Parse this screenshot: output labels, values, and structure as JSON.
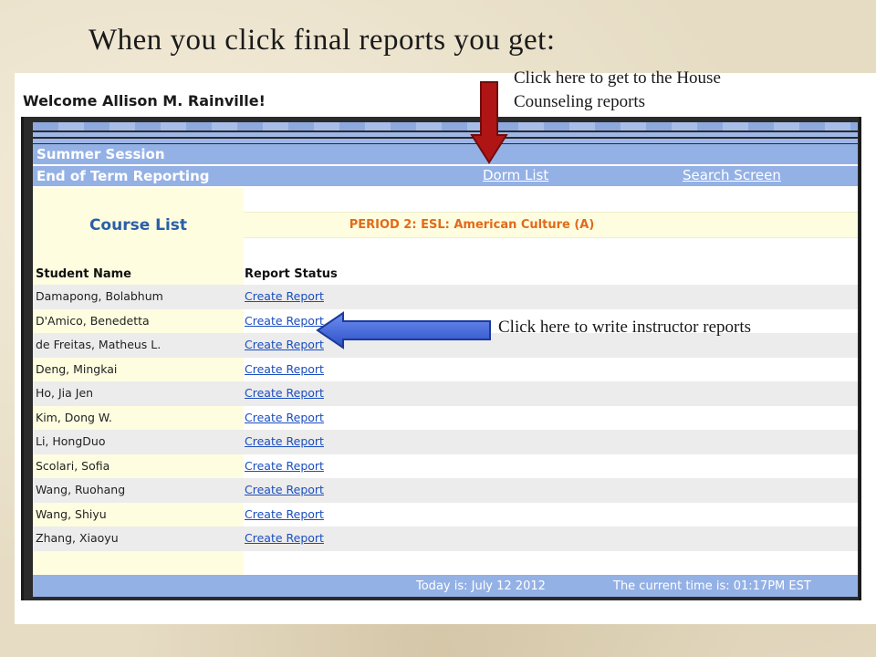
{
  "slide": {
    "title": "When you click final reports you get:"
  },
  "annotations": {
    "top_line1": "Click here to get to the House",
    "top_line2": "Counseling reports",
    "middle": "Click here to write instructor reports",
    "down_arrow_color": "#b01515",
    "left_arrow_color": "#3d63d6"
  },
  "app": {
    "welcome": "Welcome Allison M. Rainville!",
    "session_label": "Summer Session",
    "term_label": "End of Term Reporting",
    "nav_links": {
      "dorm_list": "Dorm List",
      "search_screen": "Search Screen"
    },
    "course_list_title": "Course List",
    "period_title": "PERIOD 2: ESL: American Culture (A)",
    "table": {
      "headers": {
        "student_name": "Student Name",
        "report_status": "Report Status"
      },
      "rows": [
        {
          "name": "Damapong, Bolabhum",
          "status": "Create Report"
        },
        {
          "name": "D'Amico, Benedetta",
          "status": "Create Report"
        },
        {
          "name": "de Freitas, Matheus L.",
          "status": "Create Report"
        },
        {
          "name": "Deng, Mingkai",
          "status": "Create Report"
        },
        {
          "name": "Ho, Jia Jen",
          "status": "Create Report"
        },
        {
          "name": "Kim, Dong W.",
          "status": "Create Report"
        },
        {
          "name": "Li, HongDuo",
          "status": "Create Report"
        },
        {
          "name": "Scolari, Sofia",
          "status": "Create Report"
        },
        {
          "name": "Wang, Ruohang",
          "status": "Create Report"
        },
        {
          "name": "Wang, Shiyu",
          "status": "Create Report"
        },
        {
          "name": "Zhang, Xiaoyu",
          "status": "Create Report"
        }
      ]
    },
    "footer": {
      "date": "Today is: July 12 2012",
      "time": "The current time is: 01:17PM EST"
    },
    "colors": {
      "bar_blue": "#94b1e6",
      "course_title_blue": "#2a5ea8",
      "period_orange": "#e26a1a",
      "link_blue": "#1a4dbf",
      "cream": "#fefde0"
    }
  }
}
